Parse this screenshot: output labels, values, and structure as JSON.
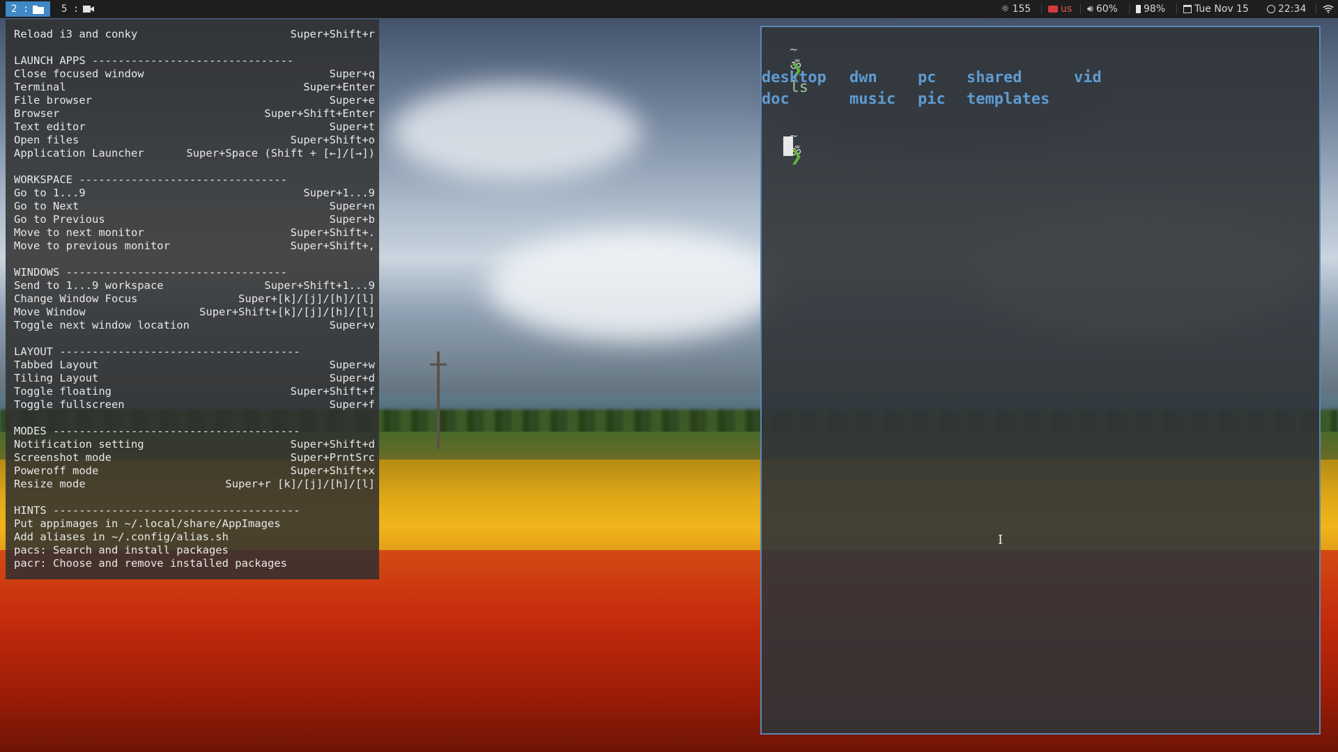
{
  "topbar": {
    "workspaces": [
      {
        "number": "2 :",
        "icon": "folder-icon"
      },
      {
        "number": "5 :",
        "icon": "video-camera-icon"
      }
    ],
    "brightness": "155",
    "keyboard_layout": "us",
    "volume": "60%",
    "battery": "98%",
    "date": "Tue Nov 15",
    "time": "22:34"
  },
  "conky": {
    "lines": [
      {
        "label": "Reload i3 and conky",
        "keys": "Super+Shift+r"
      },
      {
        "label": "",
        "keys": ""
      },
      {
        "label": "LAUNCH APPS -------------------------------",
        "keys": ""
      },
      {
        "label": "Close focused window",
        "keys": "Super+q"
      },
      {
        "label": "Terminal",
        "keys": "Super+Enter"
      },
      {
        "label": "File browser",
        "keys": "Super+e"
      },
      {
        "label": "Browser",
        "keys": "Super+Shift+Enter"
      },
      {
        "label": "Text editor",
        "keys": "Super+t"
      },
      {
        "label": "Open files",
        "keys": "Super+Shift+o"
      },
      {
        "label": "Application Launcher",
        "keys": "Super+Space (Shift + [←]/[→])"
      },
      {
        "label": "",
        "keys": ""
      },
      {
        "label": "WORKSPACE --------------------------------",
        "keys": ""
      },
      {
        "label": "Go to 1...9",
        "keys": "Super+1...9"
      },
      {
        "label": "Go to Next",
        "keys": "Super+n"
      },
      {
        "label": "Go to Previous",
        "keys": "Super+b"
      },
      {
        "label": "Move to next monitor",
        "keys": "Super+Shift+."
      },
      {
        "label": "Move to previous monitor",
        "keys": "Super+Shift+,"
      },
      {
        "label": "",
        "keys": ""
      },
      {
        "label": "WINDOWS ----------------------------------",
        "keys": ""
      },
      {
        "label": "Send to 1...9 workspace",
        "keys": "Super+Shift+1...9"
      },
      {
        "label": "Change Window Focus",
        "keys": "Super+[k]/[j]/[h]/[l]"
      },
      {
        "label": "Move Window",
        "keys": "Super+Shift+[k]/[j]/[h]/[l]"
      },
      {
        "label": "Toggle next window location",
        "keys": "Super+v"
      },
      {
        "label": "",
        "keys": ""
      },
      {
        "label": "LAYOUT -------------------------------------",
        "keys": ""
      },
      {
        "label": "Tabbed Layout",
        "keys": "Super+w"
      },
      {
        "label": "Tiling Layout",
        "keys": "Super+d"
      },
      {
        "label": "Toggle floating",
        "keys": "Super+Shift+f"
      },
      {
        "label": "Toggle fullscreen",
        "keys": "Super+f"
      },
      {
        "label": "",
        "keys": ""
      },
      {
        "label": "MODES --------------------------------------",
        "keys": ""
      },
      {
        "label": "Notification setting",
        "keys": "Super+Shift+d"
      },
      {
        "label": "Screenshot mode",
        "keys": "Super+PrntSrc"
      },
      {
        "label": "Poweroff mode",
        "keys": "Super+Shift+x"
      },
      {
        "label": "Resize mode",
        "keys": "Super+r [k]/[j]/[h]/[l]"
      },
      {
        "label": "",
        "keys": ""
      },
      {
        "label": "HINTS --------------------------------------",
        "keys": ""
      },
      {
        "label": "Put appimages in ~/.local/share/AppImages",
        "keys": ""
      },
      {
        "label": "Add aliases in ~/.config/alias.sh",
        "keys": ""
      },
      {
        "label": "pacs: Search and install packages",
        "keys": ""
      },
      {
        "label": "pacr: Choose and remove installed packages",
        "keys": ""
      }
    ]
  },
  "terminal": {
    "prompt_dir": "~",
    "prompt_symbol": "ॐ",
    "prompt_arrow": "❯",
    "command": "ls",
    "ls_output": [
      [
        "desktop",
        "dwn",
        "pc",
        "shared",
        "vid"
      ],
      [
        "doc",
        "music",
        "pic",
        "templates",
        ""
      ]
    ]
  },
  "colors": {
    "accent": "#3f87c5",
    "terminal_border": "#5d86b4",
    "prompt_green": "#5fb33a",
    "directory_blue": "#5f9bd2",
    "keyboard_red": "#d23b3b"
  }
}
